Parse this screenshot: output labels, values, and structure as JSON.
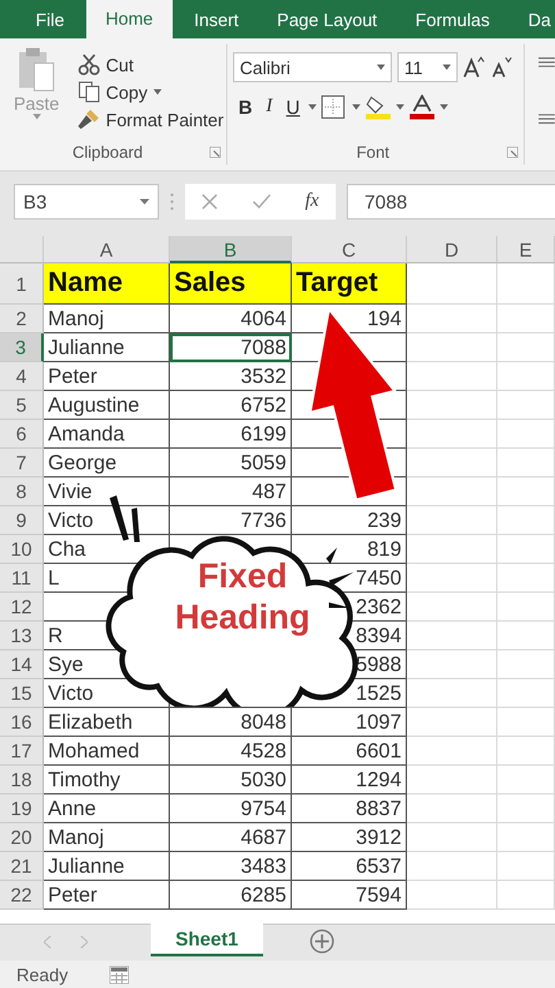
{
  "tabs": [
    {
      "label": "File",
      "selected": false
    },
    {
      "label": "Home",
      "selected": true
    },
    {
      "label": "Insert",
      "selected": false
    },
    {
      "label": "Page Layout",
      "selected": false
    },
    {
      "label": "Formulas",
      "selected": false
    },
    {
      "label": "Da",
      "selected": false
    }
  ],
  "clipboard": {
    "paste": {
      "label": "Paste",
      "disabled": true
    },
    "items": [
      {
        "kind": "cut",
        "label": "Cut"
      },
      {
        "kind": "copy",
        "label": "Copy"
      },
      {
        "kind": "painter",
        "label": "Format Painter"
      }
    ],
    "label": "Clipboard"
  },
  "font": {
    "name": "Calibri",
    "size": "11",
    "bold": "B",
    "italic": "I",
    "underline": "U",
    "label": "Font"
  },
  "formula_bar": {
    "name_box": "B3",
    "function_label": "fx",
    "formula": "7088"
  },
  "sheet": {
    "columns": [
      {
        "label": "A",
        "selected": false
      },
      {
        "label": "B",
        "selected": true
      },
      {
        "label": "C",
        "selected": false
      },
      {
        "label": "D",
        "selected": false
      },
      {
        "label": "E",
        "selected": false
      }
    ],
    "rows": [
      {
        "number": "1",
        "kind": "header",
        "selected": false,
        "cells": [
          "Name",
          "Sales",
          "Target"
        ]
      },
      {
        "number": "2",
        "kind": "data",
        "selected": false,
        "cells": [
          "Manoj",
          "4064",
          "194"
        ]
      },
      {
        "number": "3",
        "kind": "data",
        "selected": true,
        "cells": [
          "Julianne",
          "7088",
          null
        ]
      },
      {
        "number": "4",
        "kind": "data",
        "selected": false,
        "cells": [
          "Peter",
          "3532",
          null
        ]
      },
      {
        "number": "5",
        "kind": "data",
        "selected": false,
        "cells": [
          "Augustine",
          "6752",
          null
        ]
      },
      {
        "number": "6",
        "kind": "data",
        "selected": false,
        "cells": [
          "Amanda",
          "6199",
          null
        ]
      },
      {
        "number": "7",
        "kind": "data",
        "selected": false,
        "cells": [
          "George",
          "5059",
          null
        ]
      },
      {
        "number": "8",
        "kind": "data",
        "selected": false,
        "cells": [
          "Vivie",
          "487",
          null
        ]
      },
      {
        "number": "9",
        "kind": "data",
        "selected": false,
        "cells": [
          "Victo",
          "7736",
          "239"
        ]
      },
      {
        "number": "10",
        "kind": "data",
        "selected": false,
        "cells": [
          "Cha",
          null,
          "819"
        ]
      },
      {
        "number": "11",
        "kind": "data",
        "selected": false,
        "cells": [
          "L",
          null,
          "7450"
        ]
      },
      {
        "number": "12",
        "kind": "data",
        "selected": false,
        "cells": [
          null,
          null,
          "2362"
        ]
      },
      {
        "number": "13",
        "kind": "data",
        "selected": false,
        "cells": [
          "R",
          null,
          "8394"
        ]
      },
      {
        "number": "14",
        "kind": "data",
        "selected": false,
        "cells": [
          "Sye",
          null,
          "5988"
        ]
      },
      {
        "number": "15",
        "kind": "data",
        "selected": false,
        "cells": [
          "Victo",
          null,
          "1525"
        ]
      },
      {
        "number": "16",
        "kind": "data",
        "selected": false,
        "cells": [
          "Elizabeth",
          "8048",
          "1097"
        ]
      },
      {
        "number": "17",
        "kind": "data",
        "selected": false,
        "cells": [
          "Mohamed",
          "4528",
          "6601"
        ]
      },
      {
        "number": "18",
        "kind": "data",
        "selected": false,
        "cells": [
          "Timothy",
          "5030",
          "1294"
        ]
      },
      {
        "number": "19",
        "kind": "data",
        "selected": false,
        "cells": [
          "Anne",
          "9754",
          "8837"
        ]
      },
      {
        "number": "20",
        "kind": "data",
        "selected": false,
        "cells": [
          "Manoj",
          "4687",
          "3912"
        ]
      },
      {
        "number": "21",
        "kind": "data",
        "selected": false,
        "cells": [
          "Julianne",
          "3483",
          "6537"
        ]
      },
      {
        "number": "22",
        "kind": "data",
        "selected": false,
        "cells": [
          "Peter",
          "6285",
          "7594"
        ]
      }
    ]
  },
  "callout": {
    "text": "Fixed Heading"
  },
  "sheet_tabs": [
    {
      "label": "Sheet1",
      "selected": true
    }
  ],
  "status_bar": {
    "text": "Ready"
  }
}
